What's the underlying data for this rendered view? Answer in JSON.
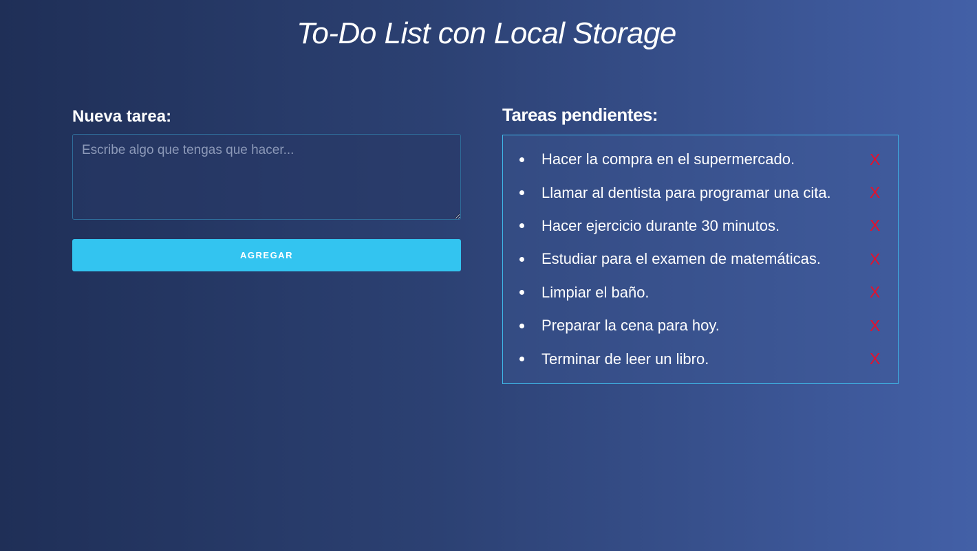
{
  "page": {
    "title": "To-Do List con Local Storage"
  },
  "form": {
    "label": "Nueva tarea:",
    "placeholder": "Escribe algo que tengas que hacer...",
    "value": "",
    "button_label": "AGREGAR"
  },
  "tasks": {
    "heading": "Tareas pendientes:",
    "delete_label": "X",
    "items": [
      {
        "text": "Hacer la compra en el supermercado."
      },
      {
        "text": "Llamar al dentista para programar una cita."
      },
      {
        "text": "Hacer ejercicio durante 30 minutos."
      },
      {
        "text": "Estudiar para el examen de matemáticas."
      },
      {
        "text": "Limpiar el baño."
      },
      {
        "text": "Preparar la cena para hoy."
      },
      {
        "text": "Terminar de leer un libro."
      }
    ]
  },
  "colors": {
    "background_start": "#1f2f57",
    "background_end": "#4360a7",
    "accent": "#33c4f0",
    "delete": "#e8102a",
    "text": "#ffffff"
  }
}
